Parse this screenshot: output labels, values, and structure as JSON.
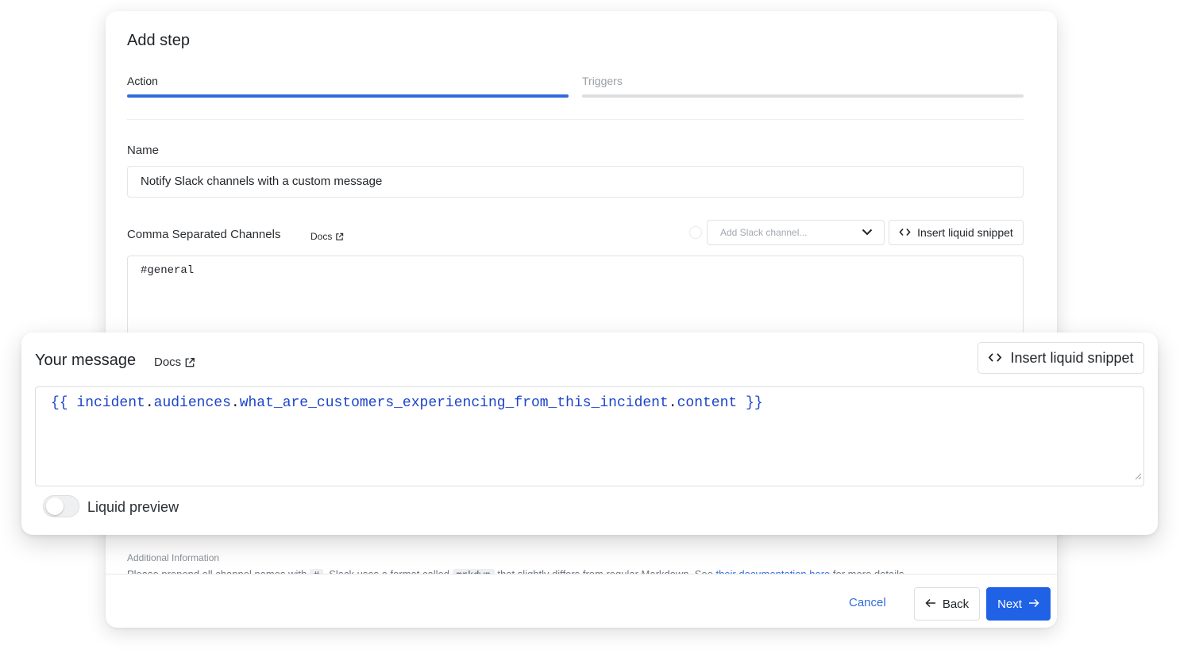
{
  "dialog": {
    "title": "Add step",
    "tabs": [
      {
        "label": "Action",
        "active": true
      },
      {
        "label": "Triggers",
        "active": false
      }
    ],
    "name_field": {
      "label": "Name",
      "value": "Notify Slack channels with a custom message"
    },
    "channels_field": {
      "label": "Comma Separated Channels",
      "docs_label": "Docs",
      "select_placeholder": "Add Slack channel...",
      "snippet_label": "Insert liquid snippet",
      "value": "#general"
    },
    "additional_info": {
      "title": "Additional Information",
      "text_part1": "Please prepend all channel names with ",
      "code1": "#",
      "text_part2": ". Slack uses a format called ",
      "code2": "mrkdwn",
      "text_part3": " that slightly differs from regular Markdown. See ",
      "link_text": "their documentation here",
      "text_part4": " for more details."
    },
    "footer": {
      "cancel_label": "Cancel",
      "back_label": "Back",
      "next_label": "Next"
    }
  },
  "message_panel": {
    "title": "Your message",
    "docs_label": "Docs",
    "snippet_label": "Insert liquid snippet",
    "code_open": "{{",
    "code_path": [
      {
        "kind": "ident",
        "text": "incident"
      },
      {
        "kind": "dot",
        "text": "."
      },
      {
        "kind": "ident",
        "text": "audiences"
      },
      {
        "kind": "dot",
        "text": "."
      },
      {
        "kind": "ident",
        "text": "what_are_customers_experiencing_from_this_incident"
      },
      {
        "kind": "dot",
        "text": "."
      },
      {
        "kind": "ident",
        "text": "content"
      }
    ],
    "code_close": "}}",
    "toggle": {
      "label": "Liquid preview",
      "enabled": false
    }
  },
  "colors": {
    "accent": "#2f6bdc",
    "primary_button": "#1f62e6",
    "code_blue": "#1d44c9"
  }
}
